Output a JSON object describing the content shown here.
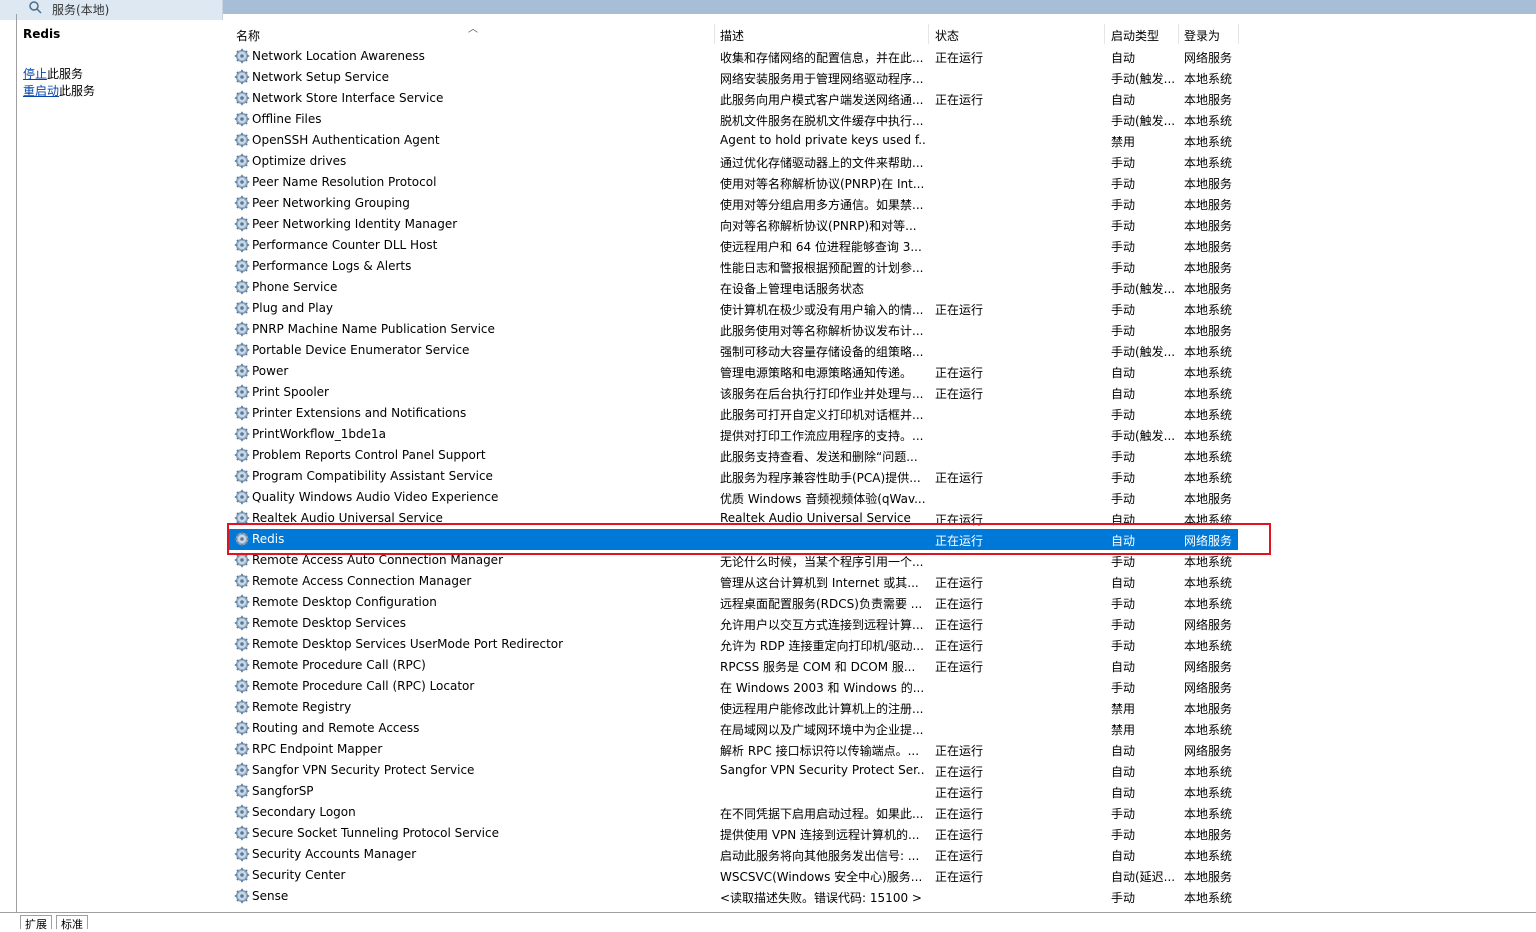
{
  "window": {
    "title": "服务(本地)"
  },
  "left_pane": {
    "service_name": "Redis",
    "stop_link": "停止",
    "stop_suffix": "此服务",
    "restart_link": "重启动",
    "restart_suffix": "此服务"
  },
  "columns": {
    "name": "名称",
    "description": "描述",
    "status": "状态",
    "startup": "启动类型",
    "logon": "登录为"
  },
  "rows": [
    {
      "name": "Network Location Awareness",
      "desc": "收集和存储网络的配置信息，并在此...",
      "status": "正在运行",
      "startup": "自动",
      "logon": "网络服务"
    },
    {
      "name": "Network Setup Service",
      "desc": "网络安装服务用于管理网络驱动程序...",
      "status": "",
      "startup": "手动(触发...",
      "logon": "本地系统"
    },
    {
      "name": "Network Store Interface Service",
      "desc": "此服务向用户模式客户端发送网络通...",
      "status": "正在运行",
      "startup": "自动",
      "logon": "本地服务"
    },
    {
      "name": "Offline Files",
      "desc": "脱机文件服务在脱机文件缓存中执行...",
      "status": "",
      "startup": "手动(触发...",
      "logon": "本地系统"
    },
    {
      "name": "OpenSSH Authentication Agent",
      "desc": "Agent to hold private keys used f...",
      "status": "",
      "startup": "禁用",
      "logon": "本地系统"
    },
    {
      "name": "Optimize drives",
      "desc": "通过优化存储驱动器上的文件来帮助...",
      "status": "",
      "startup": "手动",
      "logon": "本地系统"
    },
    {
      "name": "Peer Name Resolution Protocol",
      "desc": "使用对等名称解析协议(PNRP)在 Int...",
      "status": "",
      "startup": "手动",
      "logon": "本地服务"
    },
    {
      "name": "Peer Networking Grouping",
      "desc": "使用对等分组启用多方通信。如果禁...",
      "status": "",
      "startup": "手动",
      "logon": "本地服务"
    },
    {
      "name": "Peer Networking Identity Manager",
      "desc": "向对等名称解析协议(PNRP)和对等...",
      "status": "",
      "startup": "手动",
      "logon": "本地服务"
    },
    {
      "name": "Performance Counter DLL Host",
      "desc": "使远程用户和 64 位进程能够查询 3...",
      "status": "",
      "startup": "手动",
      "logon": "本地服务"
    },
    {
      "name": "Performance Logs & Alerts",
      "desc": "性能日志和警报根据预配置的计划参...",
      "status": "",
      "startup": "手动",
      "logon": "本地服务"
    },
    {
      "name": "Phone Service",
      "desc": "在设备上管理电话服务状态",
      "status": "",
      "startup": "手动(触发...",
      "logon": "本地服务"
    },
    {
      "name": "Plug and Play",
      "desc": "使计算机在极少或没有用户输入的情...",
      "status": "正在运行",
      "startup": "手动",
      "logon": "本地系统"
    },
    {
      "name": "PNRP Machine Name Publication Service",
      "desc": "此服务使用对等名称解析协议发布计...",
      "status": "",
      "startup": "手动",
      "logon": "本地服务"
    },
    {
      "name": "Portable Device Enumerator Service",
      "desc": "强制可移动大容量存储设备的组策略...",
      "status": "",
      "startup": "手动(触发...",
      "logon": "本地系统"
    },
    {
      "name": "Power",
      "desc": "管理电源策略和电源策略通知传递。",
      "status": "正在运行",
      "startup": "自动",
      "logon": "本地系统"
    },
    {
      "name": "Print Spooler",
      "desc": "该服务在后台执行打印作业并处理与...",
      "status": "正在运行",
      "startup": "自动",
      "logon": "本地系统"
    },
    {
      "name": "Printer Extensions and Notifications",
      "desc": "此服务可打开自定义打印机对话框并...",
      "status": "",
      "startup": "手动",
      "logon": "本地系统"
    },
    {
      "name": "PrintWorkflow_1bde1a",
      "desc": "提供对打印工作流应用程序的支持。...",
      "status": "",
      "startup": "手动(触发...",
      "logon": "本地系统"
    },
    {
      "name": "Problem Reports Control Panel Support",
      "desc": "此服务支持查看、发送和删除“问题...",
      "status": "",
      "startup": "手动",
      "logon": "本地系统"
    },
    {
      "name": "Program Compatibility Assistant Service",
      "desc": "此服务为程序兼容性助手(PCA)提供...",
      "status": "正在运行",
      "startup": "手动",
      "logon": "本地系统"
    },
    {
      "name": "Quality Windows Audio Video Experience",
      "desc": "优质 Windows 音频视频体验(qWav...",
      "status": "",
      "startup": "手动",
      "logon": "本地服务"
    },
    {
      "name": "Realtek Audio Universal Service",
      "desc": "Realtek Audio Universal Service",
      "status": "正在运行",
      "startup": "自动",
      "logon": "本地系统"
    },
    {
      "name": "Redis",
      "desc": "",
      "status": "正在运行",
      "startup": "自动",
      "logon": "网络服务",
      "selected": true
    },
    {
      "name": "Remote Access Auto Connection Manager",
      "desc": "无论什么时候，当某个程序引用一个...",
      "status": "",
      "startup": "手动",
      "logon": "本地系统"
    },
    {
      "name": "Remote Access Connection Manager",
      "desc": "管理从这台计算机到 Internet 或其...",
      "status": "正在运行",
      "startup": "自动",
      "logon": "本地系统"
    },
    {
      "name": "Remote Desktop Configuration",
      "desc": "远程桌面配置服务(RDCS)负责需要 ...",
      "status": "正在运行",
      "startup": "手动",
      "logon": "本地系统"
    },
    {
      "name": "Remote Desktop Services",
      "desc": "允许用户以交互方式连接到远程计算...",
      "status": "正在运行",
      "startup": "手动",
      "logon": "网络服务"
    },
    {
      "name": "Remote Desktop Services UserMode Port Redirector",
      "desc": "允许为 RDP 连接重定向打印机/驱动...",
      "status": "正在运行",
      "startup": "手动",
      "logon": "本地系统"
    },
    {
      "name": "Remote Procedure Call (RPC)",
      "desc": "RPCSS 服务是 COM 和 DCOM 服...",
      "status": "正在运行",
      "startup": "自动",
      "logon": "网络服务"
    },
    {
      "name": "Remote Procedure Call (RPC) Locator",
      "desc": "在 Windows 2003 和 Windows 的...",
      "status": "",
      "startup": "手动",
      "logon": "网络服务"
    },
    {
      "name": "Remote Registry",
      "desc": "使远程用户能修改此计算机上的注册...",
      "status": "",
      "startup": "禁用",
      "logon": "本地服务"
    },
    {
      "name": "Routing and Remote Access",
      "desc": "在局域网以及广域网环境中为企业提...",
      "status": "",
      "startup": "禁用",
      "logon": "本地系统"
    },
    {
      "name": "RPC Endpoint Mapper",
      "desc": "解析 RPC 接口标识符以传输端点。...",
      "status": "正在运行",
      "startup": "自动",
      "logon": "网络服务"
    },
    {
      "name": "Sangfor VPN Security Protect Service",
      "desc": "Sangfor VPN Security Protect Ser...",
      "status": "正在运行",
      "startup": "自动",
      "logon": "本地系统"
    },
    {
      "name": "SangforSP",
      "desc": "",
      "status": "正在运行",
      "startup": "自动",
      "logon": "本地系统"
    },
    {
      "name": "Secondary Logon",
      "desc": "在不同凭据下启用启动过程。如果此...",
      "status": "正在运行",
      "startup": "手动",
      "logon": "本地系统"
    },
    {
      "name": "Secure Socket Tunneling Protocol Service",
      "desc": "提供使用 VPN 连接到远程计算机的...",
      "status": "正在运行",
      "startup": "手动",
      "logon": "本地服务"
    },
    {
      "name": "Security Accounts Manager",
      "desc": "启动此服务将向其他服务发出信号: ...",
      "status": "正在运行",
      "startup": "自动",
      "logon": "本地系统"
    },
    {
      "name": "Security Center",
      "desc": "WSCSVC(Windows 安全中心)服务...",
      "status": "正在运行",
      "startup": "自动(延迟...",
      "logon": "本地服务"
    },
    {
      "name": "Sense",
      "desc": "<读取描述失败。错误代码: 15100 >",
      "status": "",
      "startup": "手动",
      "logon": "本地系统"
    }
  ],
  "bottom_tabs": {
    "extended": "扩展",
    "standard": "标准"
  },
  "colors": {
    "selected_bg": "#0078d7",
    "highlight_border": "#e0141e"
  },
  "icons": {
    "service": "gear-icon",
    "title": "search-icon"
  }
}
